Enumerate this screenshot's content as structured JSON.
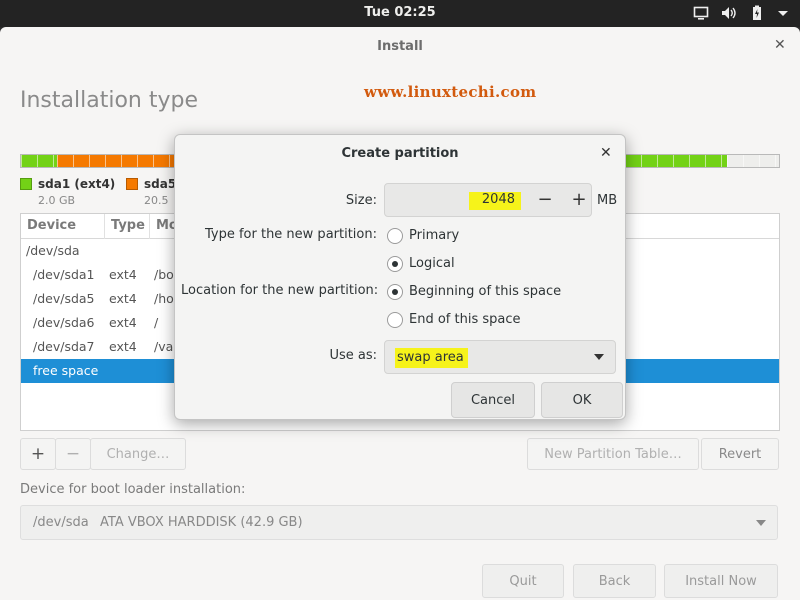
{
  "topbar": {
    "clock": "Tue 02:25",
    "tray_icons": [
      "display-icon",
      "volume-icon",
      "battery-icon",
      "power-menu-icon"
    ]
  },
  "window": {
    "title": "Install",
    "close_glyph": "✕",
    "page_title": "Installation type",
    "watermark": "www.linuxtechi.com"
  },
  "partition_bar": {
    "colors": {
      "ext4_green": "#73d216",
      "ext4_orange": "#f57900",
      "free": "#eeeeec"
    }
  },
  "legend": [
    {
      "name": "sda1 (ext4)",
      "size": "2.0 GB",
      "color": "#73d216"
    },
    {
      "name": "sda5",
      "size": "20.5",
      "color": "#f57900"
    }
  ],
  "table": {
    "headers": [
      "Device",
      "Type",
      "Mo"
    ],
    "rows": [
      {
        "device": "/dev/sda",
        "type": "",
        "mount": ""
      },
      {
        "device": "/dev/sda1",
        "type": "ext4",
        "mount": "/bo"
      },
      {
        "device": "/dev/sda5",
        "type": "ext4",
        "mount": "/ho"
      },
      {
        "device": "/dev/sda6",
        "type": "ext4",
        "mount": "/"
      },
      {
        "device": "/dev/sda7",
        "type": "ext4",
        "mount": "/va"
      },
      {
        "device": "free space",
        "type": "",
        "mount": ""
      }
    ],
    "selected_index": 5
  },
  "toolbar": {
    "add": "+",
    "remove": "−",
    "change": "Change…",
    "new_table": "New Partition Table…",
    "revert": "Revert"
  },
  "bootloader": {
    "label": "Device for boot loader installation:",
    "device": "/dev/sda",
    "description": "ATA VBOX HARDDISK (42.9 GB)"
  },
  "footer": {
    "quit": "Quit",
    "back": "Back",
    "install": "Install Now"
  },
  "dialog": {
    "title": "Create partition",
    "close_glyph": "✕",
    "size_label": "Size:",
    "size_value": "2048",
    "size_unit": "MB",
    "minus": "−",
    "plus": "+",
    "type_label": "Type for the new partition:",
    "type_options": [
      "Primary",
      "Logical"
    ],
    "type_selected": "Logical",
    "location_label": "Location for the new partition:",
    "location_options": [
      "Beginning of this space",
      "End of this space"
    ],
    "location_selected": "Beginning of this space",
    "useas_label": "Use as:",
    "useas_value": "swap area",
    "cancel": "Cancel",
    "ok": "OK",
    "highlight_color": "#f6f31a"
  }
}
